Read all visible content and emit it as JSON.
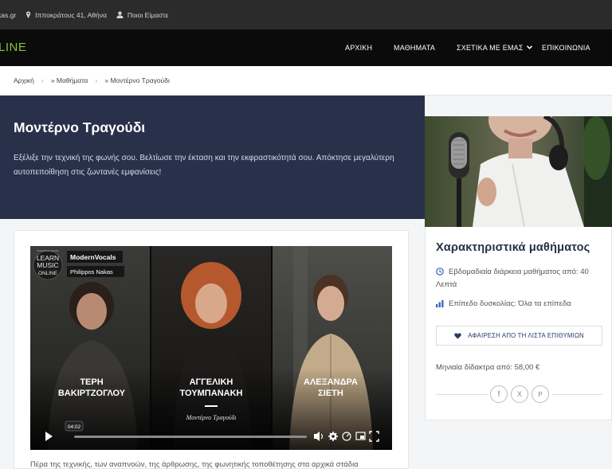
{
  "topbar": {
    "website": "kas.gr",
    "address": "Ιπποκράτους 41, Αθήνα",
    "about": "Ποιοι Είμαστε"
  },
  "header": {
    "logo": "LINE",
    "nav": {
      "home": "ΑΡΧΙΚΗ",
      "lessons": "ΜΑΘΗΜΑΤΑ",
      "about": "ΣΧΕΤΙΚΑ ΜΕ ΕΜΑΣ",
      "contact": "ΕΠΙΚΟΙΝΩΝΙΑ"
    }
  },
  "breadcrumb": {
    "home": "Αρχική",
    "lessons": "» Μαθήματα",
    "current": "» Μοντέρνο Τραγούδι"
  },
  "hero": {
    "title": "Μοντέρνο Τραγούδι",
    "subtitle": "Εξέλιξε την τεχνική της φωνής σου. Βελτίωσε την έκταση και την εκφραστικότητά σου. Απόκτησε μεγαλύτερη αυτοπεποίθηση στις ζωντανές εμφανίσεις!"
  },
  "video": {
    "logo_line1": "LEARN",
    "logo_line2": "MUSIC",
    "logo_line3": "ONLINE",
    "logo_small": "PHILIPPOS NAKAS",
    "channel": "ModernVocals",
    "author": "Philippos Nakas",
    "people": [
      {
        "first": "ΤΕΡΗ",
        "last": "ΒΑΚΙΡΤΖΟΓΛΟΥ"
      },
      {
        "first": "ΑΓΓΕΛΙΚΗ",
        "last": "ΤΟΥΜΠΑΝΑΚΗ"
      },
      {
        "first": "ΑΛΕΞΑΝΔΡΑ",
        "last": "ΣΙΕΤΗ"
      }
    ],
    "caption": "Μοντέρνο Τραγούδι",
    "time": "04:02"
  },
  "description": "Πέρα της τεχνικής, των αναπνοών, της άρθρωσης, της φωνητικής τοποθέτησης στα αρχικά στάδια",
  "sidebar": {
    "title": "Χαρακτηριστικά μαθήματος",
    "duration_line1": "Εβδομαδιαία διάρκεια μαθήματος από: 40",
    "duration_line2": "Λεπτά",
    "level": "Επίπεδο δυσκολίας: Όλα τα επίπεδα",
    "wishlist": "ΑΦΑΙΡΕΣΗ ΑΠΟ ΤΗ ΛΙΣΤΑ ΕΠΙΘΥΜΙΩΝ",
    "price": "Μηνιαία δίδακτρα από: 58,00 €",
    "share": {
      "facebook": "f",
      "x": "X",
      "pinterest": "P"
    }
  },
  "colors": {
    "hero_bg": "#28304a",
    "accent_green": "#8bbf3c",
    "title_navy": "#263046",
    "icon_blue": "#3563b5"
  }
}
